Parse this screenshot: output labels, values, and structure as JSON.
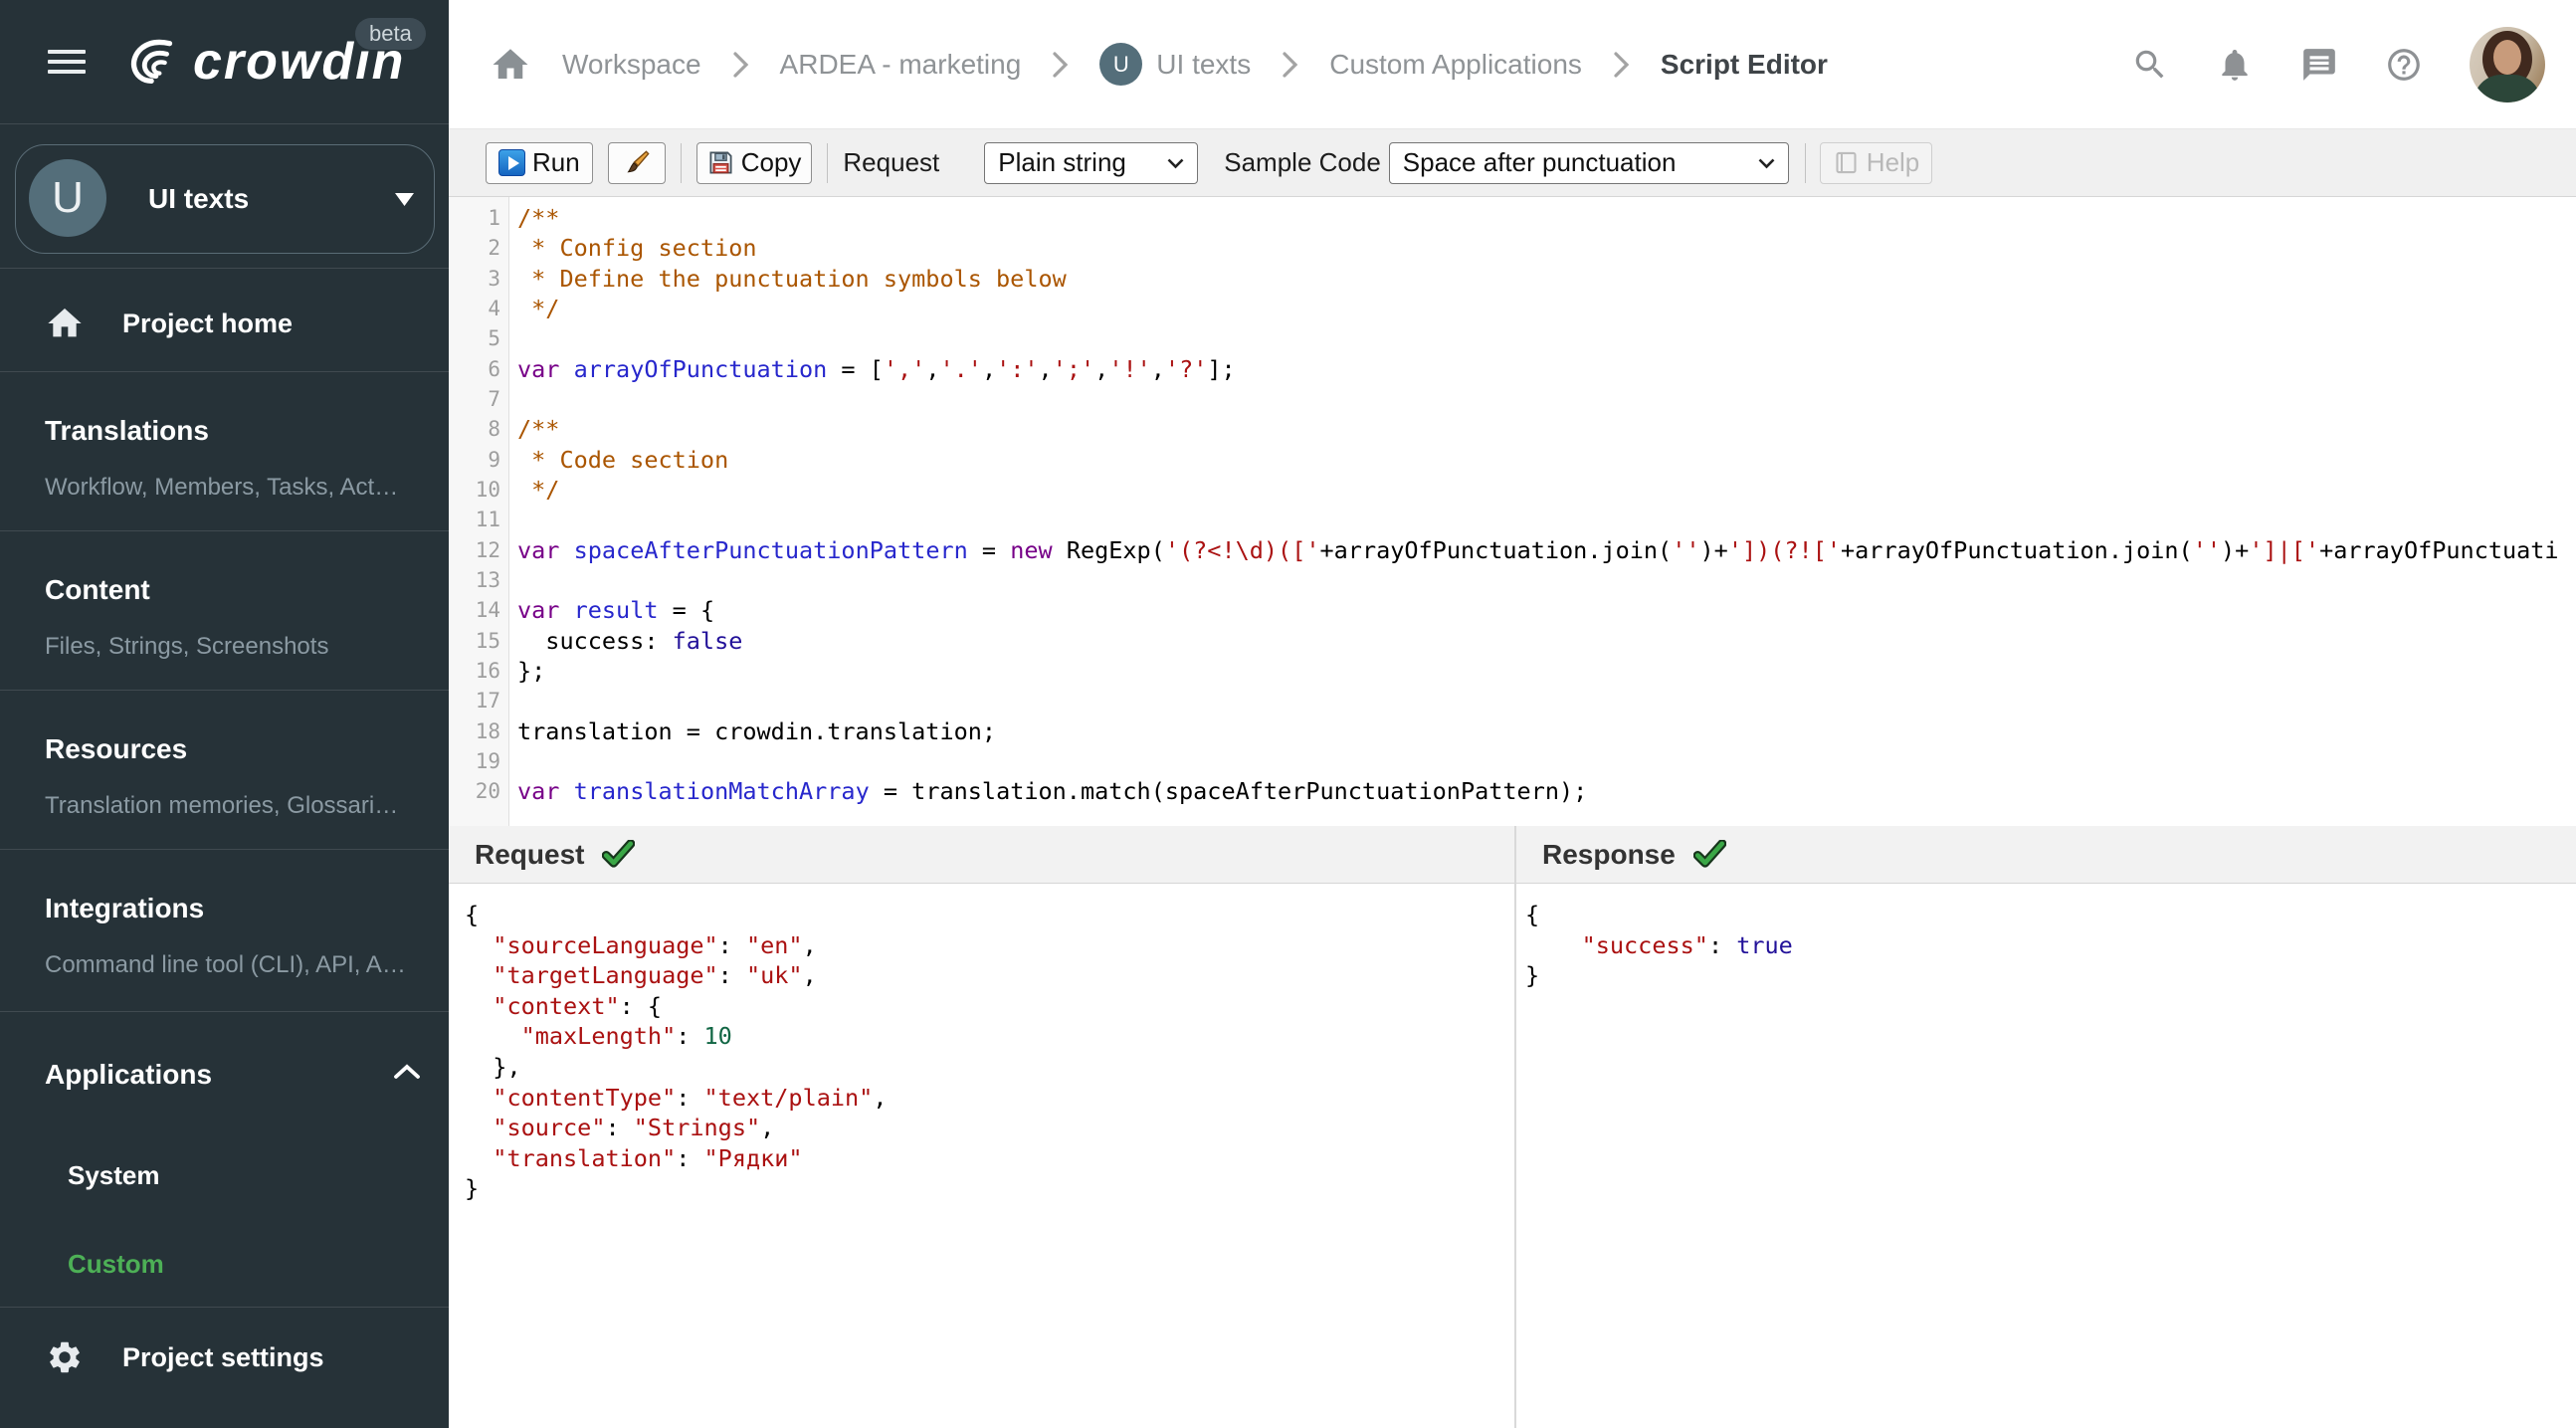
{
  "sidebar": {
    "logo_text": "crowdin",
    "beta_label": "beta",
    "project": {
      "avatar_letter": "U",
      "name": "UI texts"
    },
    "home_item": "Project home",
    "sections": [
      {
        "title": "Translations",
        "subtitle": "Workflow, Members, Tasks, Act…"
      },
      {
        "title": "Content",
        "subtitle": "Files, Strings, Screenshots"
      },
      {
        "title": "Resources",
        "subtitle": "Translation memories, Glossari…"
      },
      {
        "title": "Integrations",
        "subtitle": "Command line tool (CLI), API, A…"
      }
    ],
    "applications": {
      "title": "Applications",
      "items": [
        {
          "label": "System"
        },
        {
          "label": "Custom"
        }
      ]
    },
    "settings_item": "Project settings"
  },
  "breadcrumb": {
    "items": [
      "Workspace",
      "ARDEA - marketing",
      "UI texts",
      "Custom Applications",
      "Script Editor"
    ],
    "project_avatar_letter": "U"
  },
  "toolbar": {
    "run_label": "Run",
    "copy_label": "Copy",
    "request_label": "Request",
    "request_value": "Plain string",
    "sample_code_label": "Sample Code",
    "sample_code_value": "Space after punctuation",
    "help_label": "Help"
  },
  "colors": {
    "sidebar_bg": "#263238",
    "accent_green": "#4db056",
    "comment": "#aa5500",
    "keyword": "#770088",
    "definition": "#2727cc",
    "string": "#aa1111",
    "number": "#116644",
    "atom": "#221199"
  },
  "editor": {
    "lines": [
      {
        "n": 1,
        "t": [
          [
            "c",
            "/**"
          ]
        ]
      },
      {
        "n": 2,
        "t": [
          [
            "c",
            " * Config section"
          ]
        ]
      },
      {
        "n": 3,
        "t": [
          [
            "c",
            " * Define the punctuation symbols below"
          ]
        ]
      },
      {
        "n": 4,
        "t": [
          [
            "c",
            " */"
          ]
        ]
      },
      {
        "n": 5,
        "t": []
      },
      {
        "n": 6,
        "t": [
          [
            "k",
            "var"
          ],
          [
            "p",
            " "
          ],
          [
            "d",
            "arrayOfPunctuation"
          ],
          [
            "p",
            " = ["
          ],
          [
            "s",
            "','"
          ],
          [
            "p",
            ","
          ],
          [
            "s",
            "'.'"
          ],
          [
            "p",
            ","
          ],
          [
            "s",
            "':'"
          ],
          [
            "p",
            ","
          ],
          [
            "s",
            "';'"
          ],
          [
            "p",
            ","
          ],
          [
            "s",
            "'!'"
          ],
          [
            "p",
            ","
          ],
          [
            "s",
            "'?'"
          ],
          [
            "p",
            "];"
          ]
        ]
      },
      {
        "n": 7,
        "t": []
      },
      {
        "n": 8,
        "t": [
          [
            "c",
            "/**"
          ]
        ]
      },
      {
        "n": 9,
        "t": [
          [
            "c",
            " * Code section"
          ]
        ]
      },
      {
        "n": 10,
        "t": [
          [
            "c",
            " */"
          ]
        ]
      },
      {
        "n": 11,
        "t": []
      },
      {
        "n": 12,
        "t": [
          [
            "k",
            "var"
          ],
          [
            "p",
            " "
          ],
          [
            "d",
            "spaceAfterPunctuationPattern"
          ],
          [
            "p",
            " = "
          ],
          [
            "k",
            "new"
          ],
          [
            "p",
            " RegExp("
          ],
          [
            "s",
            "'(?<!\\d)(['"
          ],
          [
            "p",
            "+arrayOfPunctuation.join("
          ],
          [
            "s",
            "''"
          ],
          [
            "p",
            ")+"
          ],
          [
            "s",
            "'])(?!['"
          ],
          [
            "p",
            "+arrayOfPunctuation.join("
          ],
          [
            "s",
            "''"
          ],
          [
            "p",
            ")+"
          ],
          [
            "s",
            "']|['"
          ],
          [
            "p",
            "+arrayOfPunctuati"
          ]
        ]
      },
      {
        "n": 13,
        "t": []
      },
      {
        "n": 14,
        "t": [
          [
            "k",
            "var"
          ],
          [
            "p",
            " "
          ],
          [
            "d",
            "result"
          ],
          [
            "p",
            " = {"
          ]
        ]
      },
      {
        "n": 15,
        "t": [
          [
            "p",
            "  success: "
          ],
          [
            "a",
            "false"
          ]
        ]
      },
      {
        "n": 16,
        "t": [
          [
            "p",
            "};"
          ]
        ]
      },
      {
        "n": 17,
        "t": []
      },
      {
        "n": 18,
        "t": [
          [
            "p",
            "translation = crowdin.translation;"
          ]
        ]
      },
      {
        "n": 19,
        "t": []
      },
      {
        "n": 20,
        "t": [
          [
            "k",
            "var"
          ],
          [
            "p",
            " "
          ],
          [
            "d",
            "translationMatchArray"
          ],
          [
            "p",
            " = translation.match(spaceAfterPunctuationPattern);"
          ]
        ]
      }
    ]
  },
  "request_panel": {
    "title": "Request",
    "status": "success",
    "lines": [
      {
        "t": [
          [
            "p",
            "{"
          ]
        ]
      },
      {
        "t": [
          [
            "p",
            "  "
          ],
          [
            "s",
            "\"sourceLanguage\""
          ],
          [
            "p",
            ": "
          ],
          [
            "s",
            "\"en\""
          ],
          [
            "p",
            ","
          ]
        ]
      },
      {
        "t": [
          [
            "p",
            "  "
          ],
          [
            "s",
            "\"targetLanguage\""
          ],
          [
            "p",
            ": "
          ],
          [
            "s",
            "\"uk\""
          ],
          [
            "p",
            ","
          ]
        ]
      },
      {
        "t": [
          [
            "p",
            "  "
          ],
          [
            "s",
            "\"context\""
          ],
          [
            "p",
            ": {"
          ]
        ]
      },
      {
        "t": [
          [
            "p",
            "    "
          ],
          [
            "s",
            "\"maxLength\""
          ],
          [
            "p",
            ": "
          ],
          [
            "n",
            "10"
          ]
        ]
      },
      {
        "t": [
          [
            "p",
            "  },"
          ]
        ]
      },
      {
        "t": [
          [
            "p",
            "  "
          ],
          [
            "s",
            "\"contentType\""
          ],
          [
            "p",
            ": "
          ],
          [
            "s",
            "\"text/plain\""
          ],
          [
            "p",
            ","
          ]
        ]
      },
      {
        "t": [
          [
            "p",
            "  "
          ],
          [
            "s",
            "\"source\""
          ],
          [
            "p",
            ": "
          ],
          [
            "s",
            "\"Strings\""
          ],
          [
            "p",
            ","
          ]
        ]
      },
      {
        "t": [
          [
            "p",
            "  "
          ],
          [
            "s",
            "\"translation\""
          ],
          [
            "p",
            ": "
          ],
          [
            "s",
            "\"Рядки\""
          ]
        ]
      },
      {
        "t": [
          [
            "p",
            "}"
          ]
        ]
      }
    ]
  },
  "response_panel": {
    "title": "Response",
    "status": "success",
    "lines": [
      {
        "t": [
          [
            "p",
            "{"
          ]
        ]
      },
      {
        "t": [
          [
            "p",
            "    "
          ],
          [
            "s",
            "\"success\""
          ],
          [
            "p",
            ": "
          ],
          [
            "a",
            "true"
          ]
        ]
      },
      {
        "t": [
          [
            "p",
            "}"
          ]
        ]
      }
    ]
  }
}
